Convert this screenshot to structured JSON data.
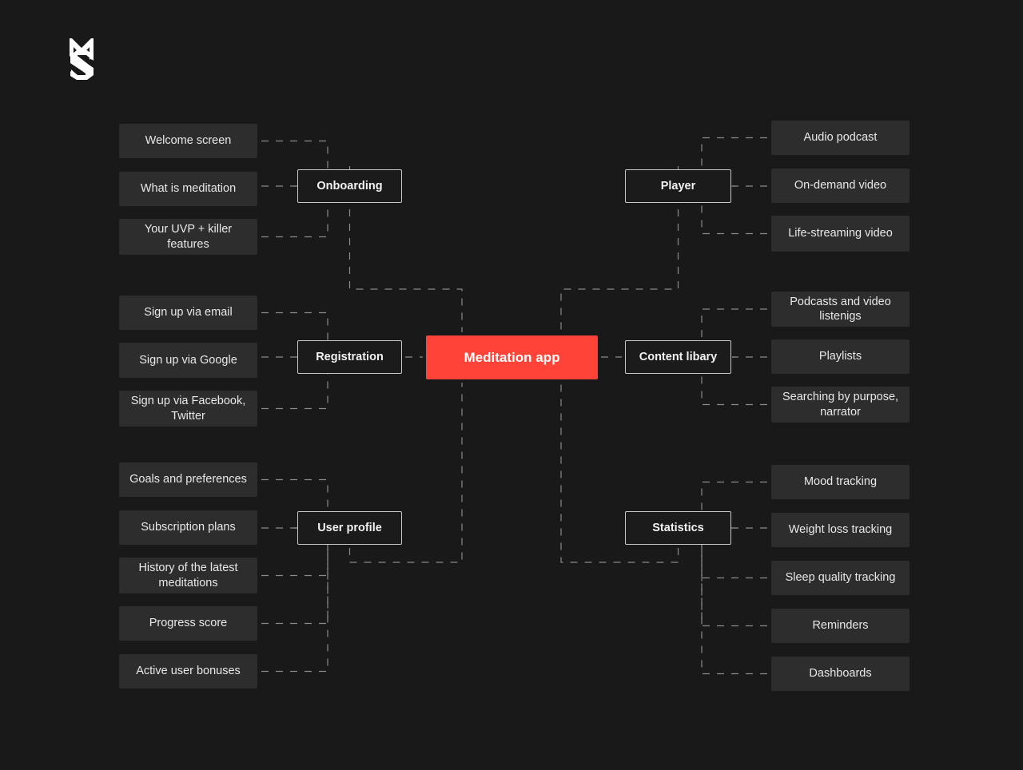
{
  "meta": {
    "background_color": "#191919",
    "leaf_color": "#2d2d2d",
    "branch_border_color": "#c9c9c9",
    "accent_color": "#ff4338",
    "connector_color": "#8a8a8a",
    "text_color": "#e8e8e8"
  },
  "logo": {
    "name": "ms-monogram-logo",
    "color": "#ffffff"
  },
  "center": {
    "label": "Meditation app"
  },
  "branches": [
    {
      "id": "onboarding",
      "label": "Onboarding",
      "side": "left",
      "leaves": [
        {
          "label": "Welcome screen"
        },
        {
          "label": "What is meditation"
        },
        {
          "label": "Your UVP + killer features"
        }
      ]
    },
    {
      "id": "registration",
      "label": "Registration",
      "side": "left",
      "leaves": [
        {
          "label": "Sign up via email"
        },
        {
          "label": "Sign up via Google"
        },
        {
          "label": "Sign up via Facebook, Twitter"
        }
      ]
    },
    {
      "id": "user-profile",
      "label": "User profile",
      "side": "left",
      "leaves": [
        {
          "label": "Goals and preferences"
        },
        {
          "label": "Subscription plans"
        },
        {
          "label": "History of the latest meditations"
        },
        {
          "label": "Progress score"
        },
        {
          "label": "Active user bonuses"
        }
      ]
    },
    {
      "id": "player",
      "label": "Player",
      "side": "right",
      "leaves": [
        {
          "label": "Audio podcast"
        },
        {
          "label": "On-demand video"
        },
        {
          "label": "Life-streaming video"
        }
      ]
    },
    {
      "id": "content-library",
      "label": "Content libary",
      "side": "right",
      "leaves": [
        {
          "label": "Podcasts and video listenigs"
        },
        {
          "label": "Playlists"
        },
        {
          "label": "Searching by purpose, narrator"
        }
      ]
    },
    {
      "id": "statistics",
      "label": "Statistics",
      "side": "right",
      "leaves": [
        {
          "label": "Mood tracking"
        },
        {
          "label": "Weight loss tracking"
        },
        {
          "label": "Sleep quality tracking"
        },
        {
          "label": "Reminders"
        },
        {
          "label": "Dashboards"
        }
      ]
    }
  ]
}
